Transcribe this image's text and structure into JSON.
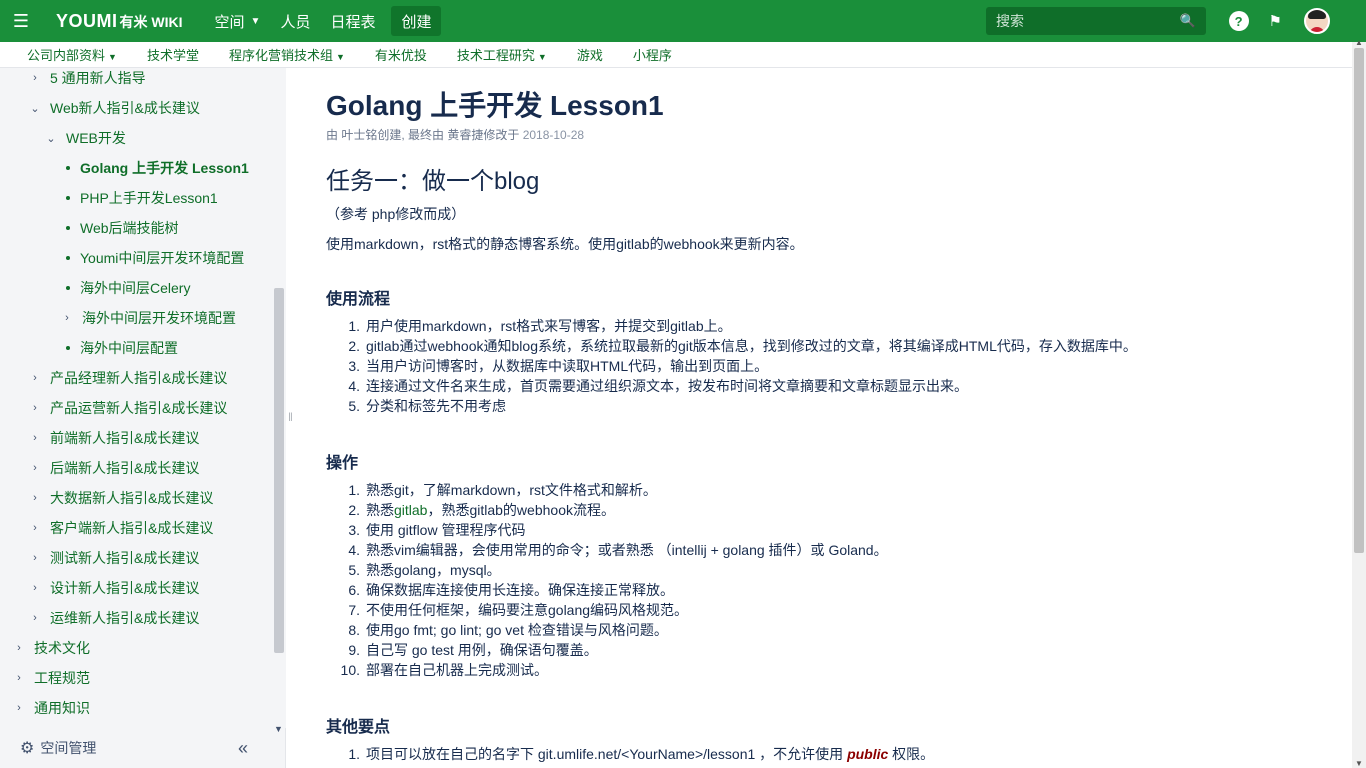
{
  "topbar": {
    "logo_mark": "YOUMI",
    "logo_text": "有米 WIKI",
    "nav": [
      {
        "label": "空间",
        "has_caret": true
      },
      {
        "label": "人员",
        "has_caret": false
      },
      {
        "label": "日程表",
        "has_caret": false
      }
    ],
    "create_label": "创建",
    "search_placeholder": "搜索",
    "help_icon": "?"
  },
  "subnav": [
    {
      "label": "公司内部资料",
      "caret": true
    },
    {
      "label": "技术学堂",
      "caret": false
    },
    {
      "label": "程序化营销技术组",
      "caret": true
    },
    {
      "label": "有米优投",
      "caret": false
    },
    {
      "label": "技术工程研究",
      "caret": true
    },
    {
      "label": "游戏",
      "caret": false
    },
    {
      "label": "小程序",
      "caret": false
    }
  ],
  "sidebar": {
    "items": [
      {
        "label": "5 通用新人指导",
        "type": "collapsed",
        "level": 1
      },
      {
        "label": "Web新人指引&成长建议",
        "type": "expanded",
        "level": 1
      },
      {
        "label": "WEB开发",
        "type": "expanded",
        "level": 2
      },
      {
        "label": "Golang 上手开发 Lesson1",
        "type": "leaf",
        "level": 3,
        "active": true
      },
      {
        "label": "PHP上手开发Lesson1",
        "type": "leaf",
        "level": 3
      },
      {
        "label": "Web后端技能树",
        "type": "leaf",
        "level": 3
      },
      {
        "label": "Youmi中间层开发环境配置",
        "type": "leaf",
        "level": 3
      },
      {
        "label": "海外中间层Celery",
        "type": "leaf",
        "level": 3
      },
      {
        "label": "海外中间层开发环境配置",
        "type": "collapsed",
        "level": 3
      },
      {
        "label": "海外中间层配置",
        "type": "leaf",
        "level": 3
      },
      {
        "label": "产品经理新人指引&成长建议",
        "type": "collapsed",
        "level": 1
      },
      {
        "label": "产品运营新人指引&成长建议",
        "type": "collapsed",
        "level": 1
      },
      {
        "label": "前端新人指引&成长建议",
        "type": "collapsed",
        "level": 1
      },
      {
        "label": "后端新人指引&成长建议",
        "type": "collapsed",
        "level": 1
      },
      {
        "label": "大数据新人指引&成长建议",
        "type": "collapsed",
        "level": 1
      },
      {
        "label": "客户端新人指引&成长建议",
        "type": "collapsed",
        "level": 1
      },
      {
        "label": "测试新人指引&成长建议",
        "type": "collapsed",
        "level": 1
      },
      {
        "label": "设计新人指引&成长建议",
        "type": "collapsed",
        "level": 1
      },
      {
        "label": "运维新人指引&成长建议",
        "type": "collapsed",
        "level": 1
      },
      {
        "label": "技术文化",
        "type": "collapsed",
        "level": 0
      },
      {
        "label": "工程规范",
        "type": "collapsed",
        "level": 0
      },
      {
        "label": "通用知识",
        "type": "collapsed",
        "level": 0
      }
    ],
    "space_admin_label": "空间管理"
  },
  "page": {
    "title": "Golang 上手开发 Lesson1",
    "byline_prefix": "由 叶士铭创建, 最终由 黄睿捷修改于",
    "byline_date": "2018-10-28",
    "task_heading": "任务一：做一个blog",
    "ref_note": "（参考 php修改而成）",
    "intro": "使用markdown，rst格式的静态博客系统。使用gitlab的webhook来更新内容。",
    "flow_heading": "使用流程",
    "flow_items": [
      "用户使用markdown，rst格式来写博客，并提交到gitlab上。",
      "gitlab通过webhook通知blog系统，系统拉取最新的git版本信息，找到修改过的文章，将其编译成HTML代码，存入数据库中。",
      "当用户访问博客时，从数据库中读取HTML代码，输出到页面上。",
      "连接通过文件名来生成，首页需要通过组织源文本，按发布时间将文章摘要和文章标题显示出来。",
      "分类和标签先不用考虑"
    ],
    "ops_heading": "操作",
    "ops_items": [
      "熟悉git，了解markdown，rst文件格式和解析。",
      "熟悉gitlab，熟悉gitlab的webhook流程。",
      "使用 gitflow 管理程序代码",
      "熟悉vim编辑器，会使用常用的命令；或者熟悉 （intellij + golang 插件）或 Goland。",
      "熟悉golang，mysql。",
      "确保数据库连接使用长连接。确保连接正常释放。",
      "不使用任何框架，编码要注意golang编码风格规范。",
      "使用go fmt; go lint; go vet 检查错误与风格问题。",
      "自己写 go test 用例，确保语句覆盖。",
      "部署在自己机器上完成测试。"
    ],
    "ops_item2_link": "gitlab",
    "ops_item2_prefix": "熟悉",
    "ops_item2_suffix": "，熟悉gitlab的webhook流程。",
    "other_heading": "其他要点",
    "other_item1_prefix": "项目可以放在自己的名字下 git.umlife.net/<YourName>/lesson1 ，不允许使用 ",
    "other_item1_emph": "public",
    "other_item1_suffix": " 权限。"
  },
  "colors": {
    "brand_green": "#1a8f3a",
    "link_green": "#0f6e29",
    "emphasis_red": "#8b0000"
  }
}
